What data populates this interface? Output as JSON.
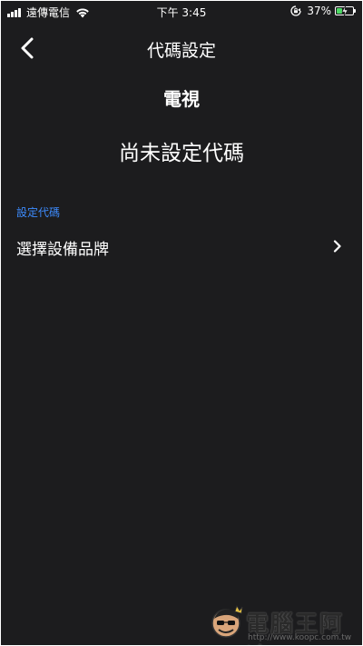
{
  "status_bar": {
    "carrier": "遠傳電信",
    "time": "下午 3:45",
    "battery_percent": "37%",
    "battery_level": 0.37,
    "icons": [
      "signal-icon",
      "wifi-icon",
      "rotation-lock-icon",
      "battery-charging-icon"
    ]
  },
  "nav": {
    "title": "代碼設定",
    "back_icon": "chevron-left-icon"
  },
  "device": {
    "name": "電視",
    "code_status": "尚未設定代碼"
  },
  "section": {
    "header": "設定代碼",
    "rows": [
      {
        "label": "選擇設備品牌",
        "icon": "chevron-right-icon"
      }
    ]
  },
  "colors": {
    "background": "#1c1c1e",
    "accent": "#3d8bfd",
    "text": "#ffffff",
    "battery_charge": "#4cd964"
  },
  "watermark": {
    "brand": "電腦王阿達",
    "url": "http://www.koopc.com.tw"
  }
}
